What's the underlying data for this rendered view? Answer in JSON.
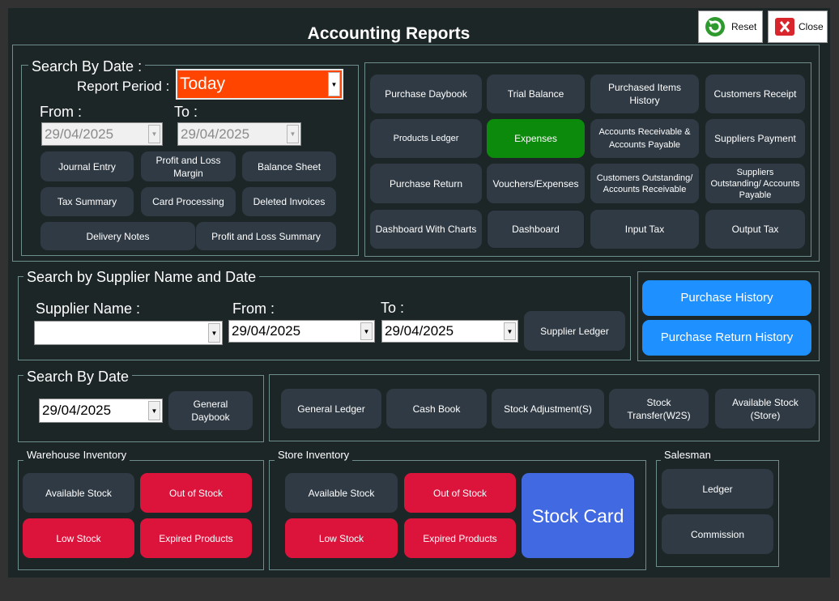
{
  "window": {
    "title": "Accounting Reports",
    "reset_label": "Reset",
    "close_label": "Close"
  },
  "search_by_date": {
    "legend": "Search By Date :",
    "report_period_label": "Report Period :",
    "report_period_value": "Today",
    "from_label": "From :",
    "to_label": "To :",
    "from_value": "29/04/2025",
    "to_value": "29/04/2025",
    "buttons": [
      "Journal Entry",
      "Profit and Loss Margin",
      "Balance Sheet",
      "Tax Summary",
      "Card Processing",
      "Deleted Invoices",
      "Delivery Notes",
      "Profit and Loss Summary"
    ]
  },
  "report_grid": {
    "buttons": [
      "Purchase Daybook",
      "Trial Balance",
      "Purchased Items History",
      "Customers Receipt",
      "Products Ledger",
      "Expenses",
      "Accounts Receivable & Accounts Payable",
      "Suppliers Payment",
      "Purchase Return",
      "Vouchers/Expenses",
      "Customers Outstanding/ Accounts Receivable",
      "Suppliers Outstanding/ Accounts Payable",
      "Dashboard With Charts",
      "Dashboard",
      "Input Tax",
      "Output Tax"
    ]
  },
  "supplier_search": {
    "legend": "Search by Supplier Name and Date",
    "supplier_label": "Supplier Name :",
    "supplier_value": "",
    "from_label": "From :",
    "to_label": "To :",
    "from_value": "29/04/2025",
    "to_value": "29/04/2025",
    "ledger_button": "Supplier Ledger"
  },
  "purchase_history": {
    "history_button": "Purchase History",
    "return_history_button": "Purchase Return History"
  },
  "date_search2": {
    "legend": "Search By Date",
    "date_value": "29/04/2025",
    "general_daybook_button": "General Daybook"
  },
  "ledger_row": {
    "buttons": [
      "General Ledger",
      "Cash Book",
      "Stock Adjustment(S)",
      "Stock Transfer(W2S)",
      "Available Stock (Store)"
    ]
  },
  "warehouse_inventory": {
    "legend": "Warehouse Inventory",
    "available_stock": "Available Stock",
    "out_of_stock": "Out of Stock",
    "low_stock": "Low Stock",
    "expired_products": "Expired Products"
  },
  "store_inventory": {
    "legend": "Store Inventory",
    "available_stock": "Available Stock",
    "out_of_stock": "Out of Stock",
    "low_stock": "Low Stock",
    "expired_products": "Expired Products",
    "stock_card": "Stock Card"
  },
  "salesman": {
    "legend": "Salesman",
    "ledger": "Ledger",
    "commission": "Commission"
  },
  "colors": {
    "window_bg": "#1d2627",
    "button_dark": "#2f3a44",
    "button_red": "#dc143c",
    "button_blue": "#1e90ff",
    "button_green": "#0b8a0b",
    "stock_card": "#4169e1",
    "period_bg": "#ff4500"
  }
}
